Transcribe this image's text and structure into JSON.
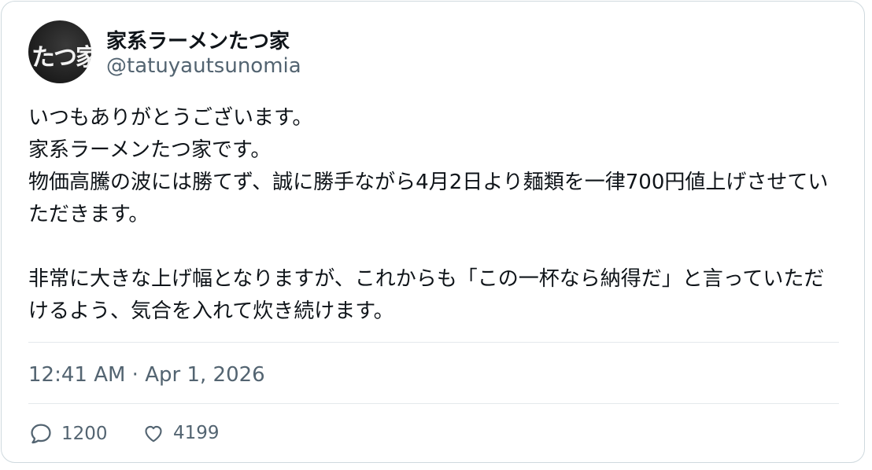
{
  "author": {
    "display_name": "家系ラーメンたつ家",
    "handle": "@tatuyautsunomia",
    "avatar_text": "たつ家"
  },
  "tweet": {
    "text": "いつもありがとうございます。\n家系ラーメンたつ家です。\n物価高騰の波には勝てず、誠に勝手ながら4月2日より麺類を一律700円値上げさせていただきます。\n\n非常に大きな上げ幅となりますが、これからも「この一杯なら納得だ」と言っていただけるよう、気合を入れて炊き続けます。",
    "timestamp": "12:41 AM · Apr 1, 2026"
  },
  "stats": {
    "replies": "1200",
    "likes": "4199"
  },
  "icons": {
    "reply": "comment-bubble-icon",
    "like": "heart-icon"
  }
}
